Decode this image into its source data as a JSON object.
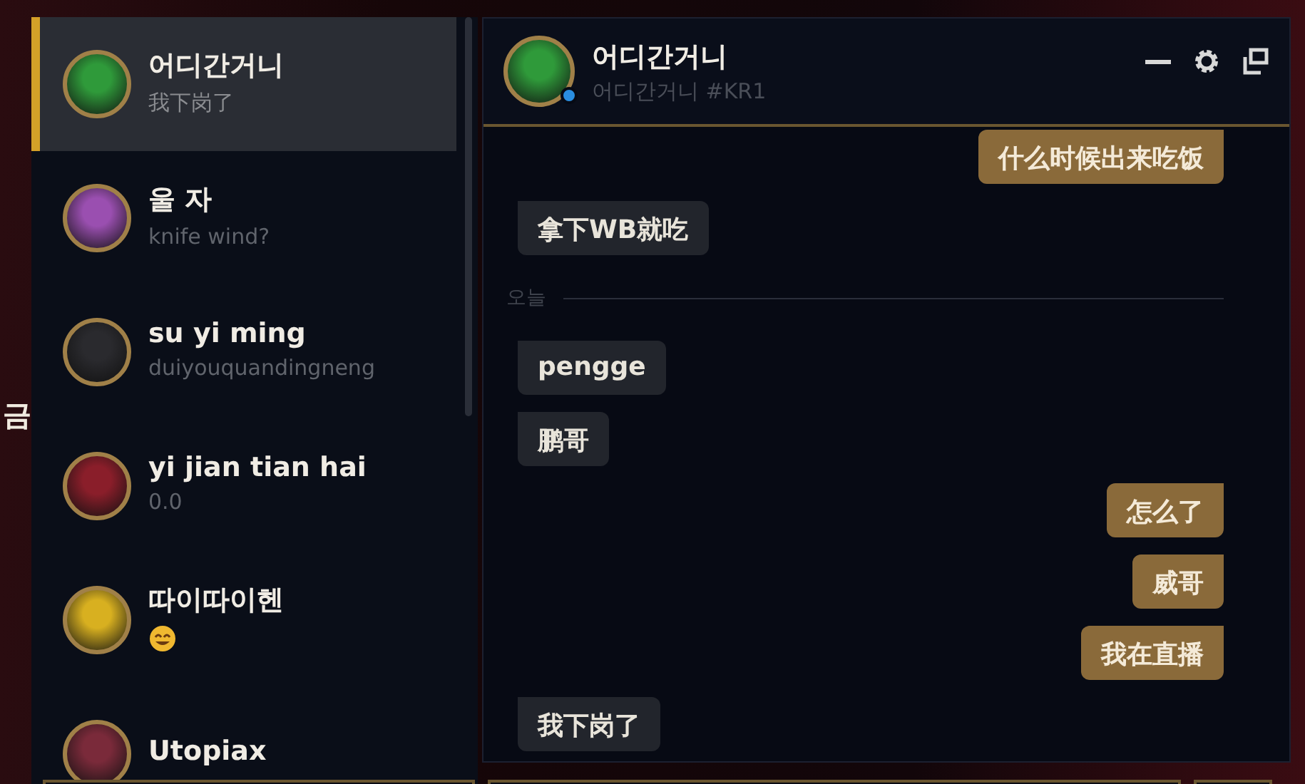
{
  "background": {
    "label": "금"
  },
  "friends": [
    {
      "name": "어디간거니",
      "status": "我下岗了",
      "selected": true,
      "color": "#2f9a3a"
    },
    {
      "name": "울 자",
      "status": "knife wind?",
      "selected": false,
      "color": "#9a4fb0"
    },
    {
      "name": "su yi ming",
      "status": "duiyouquandingneng",
      "selected": false,
      "color": "#2a2a2e"
    },
    {
      "name": "yi jian tian hai",
      "status": "0.0",
      "selected": false,
      "color": "#8a1e2a"
    },
    {
      "name": "따이따이헨",
      "status_emoji": true,
      "selected": false,
      "color": "#d8b020"
    },
    {
      "name": "Utopiax",
      "selected": false,
      "color": "#7a2a3a"
    }
  ],
  "chat": {
    "name": "어디간거니",
    "tag": "어디간거니 #KR1",
    "online": true,
    "color": "#2f9a3a",
    "messages": [
      {
        "kind": "mine",
        "text": "什么时候出来吃饭"
      },
      {
        "kind": "theirs",
        "text": "拿下WB就吃"
      },
      {
        "kind": "date",
        "text": "오늘"
      },
      {
        "kind": "theirs",
        "text": "pengge"
      },
      {
        "kind": "theirs",
        "text": "鹏哥"
      },
      {
        "kind": "mine",
        "text": "怎么了"
      },
      {
        "kind": "mine",
        "text": "威哥"
      },
      {
        "kind": "mine",
        "text": "我在直播"
      },
      {
        "kind": "theirs",
        "text": "我下岗了"
      }
    ]
  }
}
